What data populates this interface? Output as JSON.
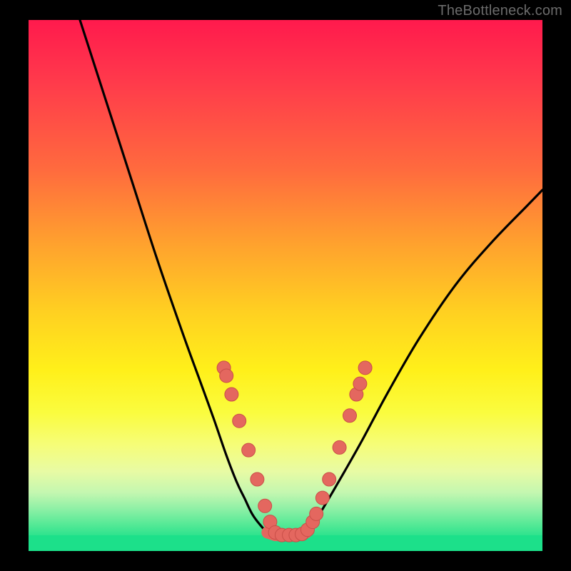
{
  "watermark": "TheBottleneck.com",
  "colors": {
    "frame": "#000000",
    "curve_stroke": "#000000",
    "dot_fill": "#e4675f",
    "dot_stroke": "#c94f48",
    "bottom_band": "#1ce08a"
  },
  "chart_data": {
    "type": "line",
    "title": "",
    "xlabel": "",
    "ylabel": "",
    "xlim": [
      0,
      100
    ],
    "ylim": [
      0,
      100
    ],
    "grid": false,
    "series": [
      {
        "name": "left-branch",
        "x": [
          10,
          15,
          20,
          25,
          30,
          33,
          36,
          38.5,
          40.5,
          42,
          43.5,
          45,
          46.5
        ],
        "y": [
          100,
          85,
          70,
          55,
          41,
          33,
          25,
          18,
          13,
          10,
          7,
          5,
          3.5
        ]
      },
      {
        "name": "flat-bottom",
        "x": [
          46.5,
          48,
          50,
          52,
          54
        ],
        "y": [
          3.5,
          3,
          3,
          3,
          3.5
        ]
      },
      {
        "name": "right-branch",
        "x": [
          54,
          56,
          58.5,
          61.5,
          65,
          70,
          76,
          83,
          90,
          97,
          100
        ],
        "y": [
          3.5,
          6,
          10,
          15,
          21,
          30,
          40,
          50,
          58,
          65,
          68
        ]
      }
    ],
    "dots": {
      "name": "highlight-dots",
      "points": [
        {
          "x": 38.0,
          "y": 34.5
        },
        {
          "x": 38.5,
          "y": 33.0
        },
        {
          "x": 39.5,
          "y": 29.5
        },
        {
          "x": 41.0,
          "y": 24.5
        },
        {
          "x": 42.8,
          "y": 19.0
        },
        {
          "x": 44.5,
          "y": 13.5
        },
        {
          "x": 46.0,
          "y": 8.5
        },
        {
          "x": 47.0,
          "y": 5.5
        },
        {
          "x": 48.0,
          "y": 3.5
        },
        {
          "x": 49.3,
          "y": 3.0
        },
        {
          "x": 50.7,
          "y": 3.0
        },
        {
          "x": 52.0,
          "y": 3.0
        },
        {
          "x": 53.2,
          "y": 3.2
        },
        {
          "x": 54.3,
          "y": 4.0
        },
        {
          "x": 55.3,
          "y": 5.5
        },
        {
          "x": 56.0,
          "y": 7.0
        },
        {
          "x": 57.2,
          "y": 10.0
        },
        {
          "x": 58.5,
          "y": 13.5
        },
        {
          "x": 60.5,
          "y": 19.5
        },
        {
          "x": 62.5,
          "y": 25.5
        },
        {
          "x": 63.8,
          "y": 29.5
        },
        {
          "x": 64.5,
          "y": 31.5
        },
        {
          "x": 65.5,
          "y": 34.5
        }
      ]
    }
  }
}
